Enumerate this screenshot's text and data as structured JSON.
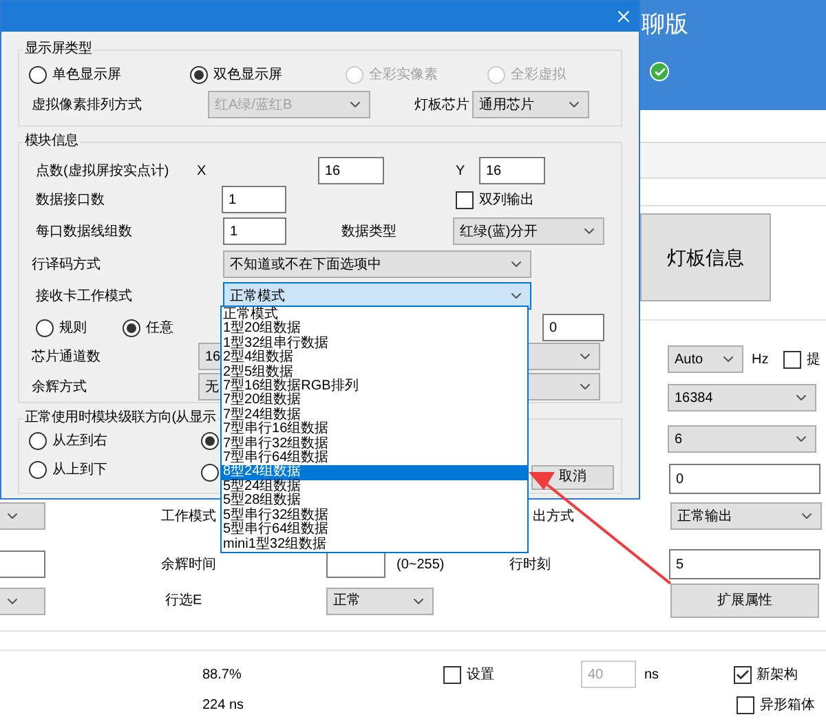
{
  "dialog": {
    "display_type": {
      "title": "显示屏类型",
      "options": [
        {
          "label": "单色显示屏",
          "selected": false,
          "disabled": false
        },
        {
          "label": "双色显示屏",
          "selected": true,
          "disabled": false
        },
        {
          "label": "全彩实像素",
          "selected": false,
          "disabled": true
        },
        {
          "label": "全彩虚拟",
          "selected": false,
          "disabled": true
        }
      ],
      "arrangement": {
        "label": "虚拟像素排列方式",
        "value": "红A绿/蓝红B",
        "disabled": true
      },
      "chip": {
        "label": "灯板芯片",
        "value": "通用芯片",
        "disabled": false
      }
    },
    "module_info": {
      "title": "模块信息",
      "points_label": "点数(虚拟屏按实点计)",
      "x_label": "X",
      "x_value": "16",
      "y_label": "Y",
      "y_value": "16",
      "ports_label": "数据接口数",
      "ports_value": "1",
      "dual_output": {
        "label": "双列输出",
        "checked": false
      },
      "groups_label": "每口数据线组数",
      "groups_value": "1",
      "data_type_label": "数据类型",
      "data_type_value": "红绿(蓝)分开",
      "decode_label": "行译码方式",
      "decode_value": "不知道或不在下面选项中",
      "mode_label": "接收卡工作模式",
      "mode_value": "正常模式",
      "mode_expanded": true,
      "arrangement_options": [
        {
          "label": "规则",
          "selected": false
        },
        {
          "label": "任意",
          "selected": true
        }
      ],
      "offset_value": "0",
      "channels_label": "芯片通道数",
      "channels_value": "16",
      "afterglow_label": "余辉方式",
      "afterglow_value": "无"
    },
    "mode_options": [
      {
        "label": "正常模式",
        "selected": false
      },
      {
        "label": "1型20组数据",
        "selected": false
      },
      {
        "label": "1型32组串行数据",
        "selected": false
      },
      {
        "label": "2型4组数据",
        "selected": false
      },
      {
        "label": "2型5组数据",
        "selected": false
      },
      {
        "label": "7型16组数据RGB排列",
        "selected": false
      },
      {
        "label": "7型20组数据",
        "selected": false
      },
      {
        "label": "7型24组数据",
        "selected": false
      },
      {
        "label": "7型串行16组数据",
        "selected": false
      },
      {
        "label": "7型串行32组数据",
        "selected": false
      },
      {
        "label": "7型串行64组数据",
        "selected": false
      },
      {
        "label": "8型24组数据",
        "selected": true
      },
      {
        "label": "5型24组数据",
        "selected": false
      },
      {
        "label": "5型28组数据",
        "selected": false
      },
      {
        "label": "5型串行32组数据",
        "selected": false
      },
      {
        "label": "5型串行64组数据",
        "selected": false
      },
      {
        "label": "mini1型32组数据",
        "selected": false
      }
    ],
    "cascade": {
      "title": "正常使用时模块级联方向(从显示",
      "options": [
        {
          "label": "从左到右",
          "selected": false
        },
        {
          "selected": true
        },
        {
          "label": "从上到下",
          "selected": false
        },
        {
          "selected": false
        }
      ]
    },
    "cancel": "取消"
  },
  "app": {
    "header_title": "聊版",
    "led_info": "灯板信息",
    "refresh": "Auto",
    "refresh_unit": "Hz",
    "refresh_check": {
      "label": "提",
      "checked": false
    },
    "gray_levels": "16384",
    "select_6": "6",
    "field_0": "0",
    "work_mode_label": "工作模式",
    "output_label": "出方式",
    "output_value": "正常输出",
    "afterglow_time_label": "余辉时间",
    "range": "(0~255)",
    "switch_label": "行时刻",
    "field_5": "5",
    "row_select_label": "行选E",
    "row_select_value": "正常",
    "extended": "扩展属性",
    "efficiency": "88.7%",
    "period": "224 ns",
    "set": {
      "label": "设置",
      "checked": false
    },
    "delay_value": "40",
    "delay_disabled": true,
    "delay_unit": "ns",
    "new_arch": {
      "label": "新架构",
      "checked": true
    },
    "irregular": {
      "label": "异形箱体",
      "checked": false
    }
  }
}
